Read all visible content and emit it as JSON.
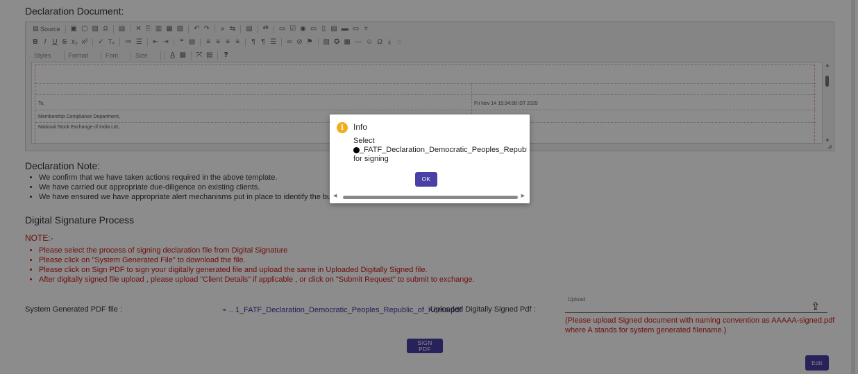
{
  "declaration_document": {
    "title": "Declaration Document:",
    "toolbar": {
      "row1": [
        "Source"
      ],
      "row3": [
        "Styles",
        "Format",
        "Font",
        "Size"
      ]
    },
    "content": {
      "to": "To,",
      "timestamp": "Fri Nov 14 15:34:58 IST 2025",
      "line1": "Membership Compliance Department,",
      "line2": "National Stock Exchange of India Ltd.,"
    }
  },
  "declaration_note": {
    "title": "Declaration Note:",
    "items": [
      "We confirm that we have taken actions required in the above template.",
      "We have carried out appropriate due-diligence on existing clients.",
      "We have ensured we have appropriate alert mechanisms put in place to identify the business relationships and t"
    ]
  },
  "digital_signature": {
    "title": "Digital Signature Process",
    "note_label": "NOTE:-",
    "notes": [
      "Please select the process of signing declaration file from Digital Signature",
      "Please click on \"System Generated File\" to download the file.",
      "Please click on Sign PDF to sign your digitally generated file and upload the same in Uploaded Digitally Signed file.",
      "After digitally signed file upload , please upload \"Client Details\" if applicable , or click on \"Submit Request\" to submit to exchange."
    ],
    "system_generated_label": "System Generated PDF file :",
    "system_generated_file": "1_FATF_Declaration_Democratic_Peoples_Republic_of_Korea.pdf",
    "uploaded_label": "Uploaded Digitally Signed Pdf :",
    "upload_field_label": "Upload",
    "upload_help": "(Please upload Signed document with naming convention as AAAAA-signed.pdf where A stands for system generated filename.)",
    "sign_pdf_button": "SIGN PDF",
    "edit_button": "Edit"
  },
  "dialog": {
    "title": "Info",
    "line1": "Select",
    "filename": "_FATF_Declaration_Democratic_Peoples_Republic_of_Korea.pc",
    "line3": "for signing",
    "ok_button": "OK"
  },
  "colors": {
    "accent": "#4a3fa5",
    "error": "#cc1a1a",
    "info_icon": "#f0ad1e"
  }
}
